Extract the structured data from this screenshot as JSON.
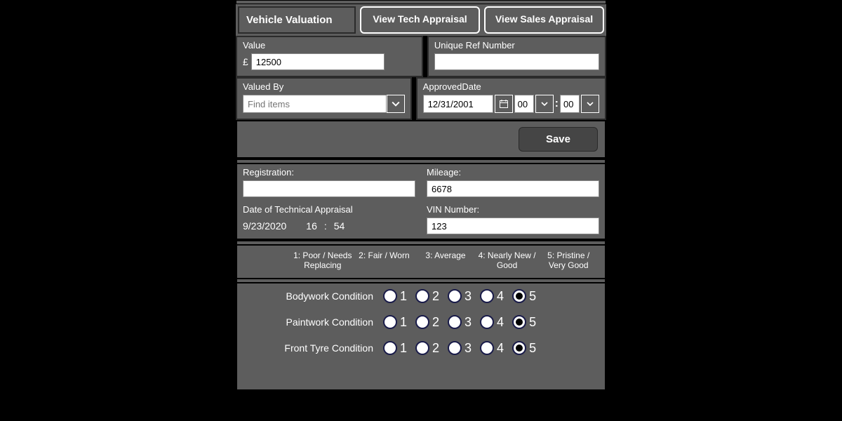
{
  "header": {
    "title": "Vehicle Valuation",
    "tech_btn": "View Tech Appraisal",
    "sales_btn": "View Sales Appraisal"
  },
  "valuation": {
    "value_label": "Value",
    "currency": "£",
    "value": "12500",
    "ref_label": "Unique Ref Number",
    "ref": "",
    "valued_by_label": "Valued By",
    "valued_by_placeholder": "Find items",
    "approved_label": "ApprovedDate",
    "approved_date": "12/31/2001",
    "approved_hour": "00",
    "approved_min": "00"
  },
  "save_label": "Save",
  "appraisal": {
    "reg_label": "Registration:",
    "reg": "",
    "mileage_label": "Mileage:",
    "mileage": "6678",
    "tech_date_label": "Date of Technical Appraisal",
    "tech_date": "9/23/2020",
    "tech_hour": "16",
    "tech_min": "54",
    "vin_label": "VIN Number:",
    "vin": "123"
  },
  "legend": {
    "c1": "1: Poor / Needs Replacing",
    "c2": "2: Fair / Worn",
    "c3": "3: Average",
    "c4": "4: Nearly New / Good",
    "c5": "5: Pristine / Very Good"
  },
  "ratings": [
    {
      "label": "Bodywork Condition",
      "value": 5
    },
    {
      "label": "Paintwork Condition",
      "value": 5
    },
    {
      "label": "Front Tyre Condition",
      "value": 5
    }
  ]
}
